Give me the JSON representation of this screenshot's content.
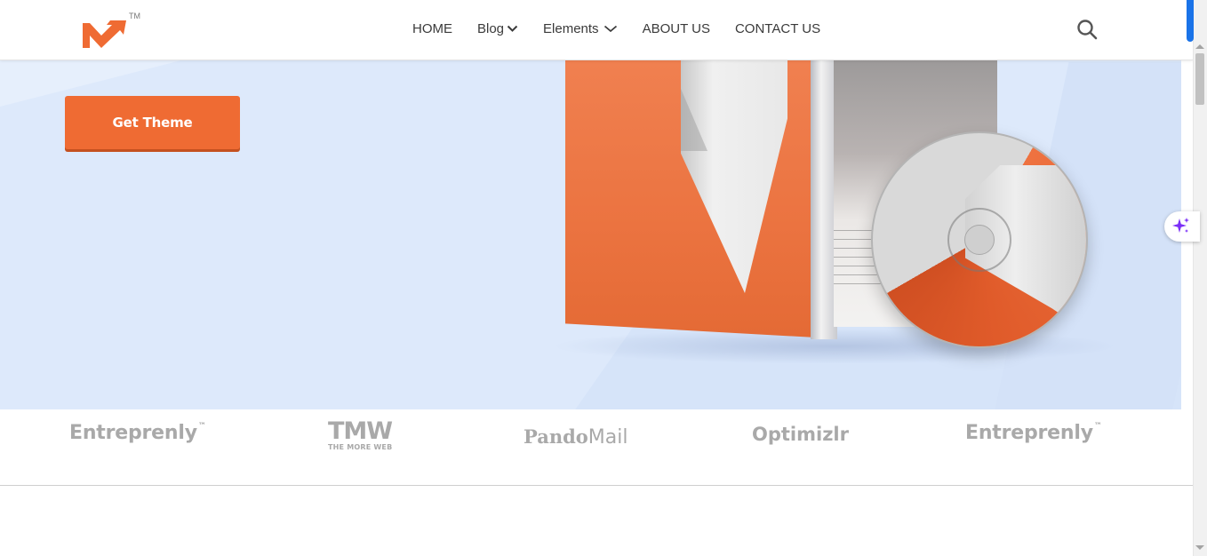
{
  "header": {
    "logo_tm": "TM",
    "nav": [
      {
        "label": "HOME"
      },
      {
        "label": "Blog"
      },
      {
        "label": "Elements"
      },
      {
        "label": "ABOUT US"
      },
      {
        "label": "CONTACT US"
      }
    ]
  },
  "hero": {
    "cta_label": "Get Theme"
  },
  "brands": {
    "entreprenly_1": "Entreprenly",
    "entreprenly_tm": "™",
    "tmw_big": "TMW",
    "tmw_small": "THE MORE WEB",
    "pando": "Pando",
    "mail": "Mail",
    "optimizlr": "Optimizlr",
    "entreprenly_2": "Entreprenly"
  },
  "colors": {
    "accent": "#ef6b33",
    "hero_bg": "#dde9fb",
    "brand_gray": "#a9a9a9",
    "chrome_blue": "#1a73e8",
    "ai_purple": "#7b2ff7"
  },
  "icons": {
    "search": "search-icon",
    "dropdown": "chevron-down-icon",
    "ai": "sparkle-icon"
  }
}
